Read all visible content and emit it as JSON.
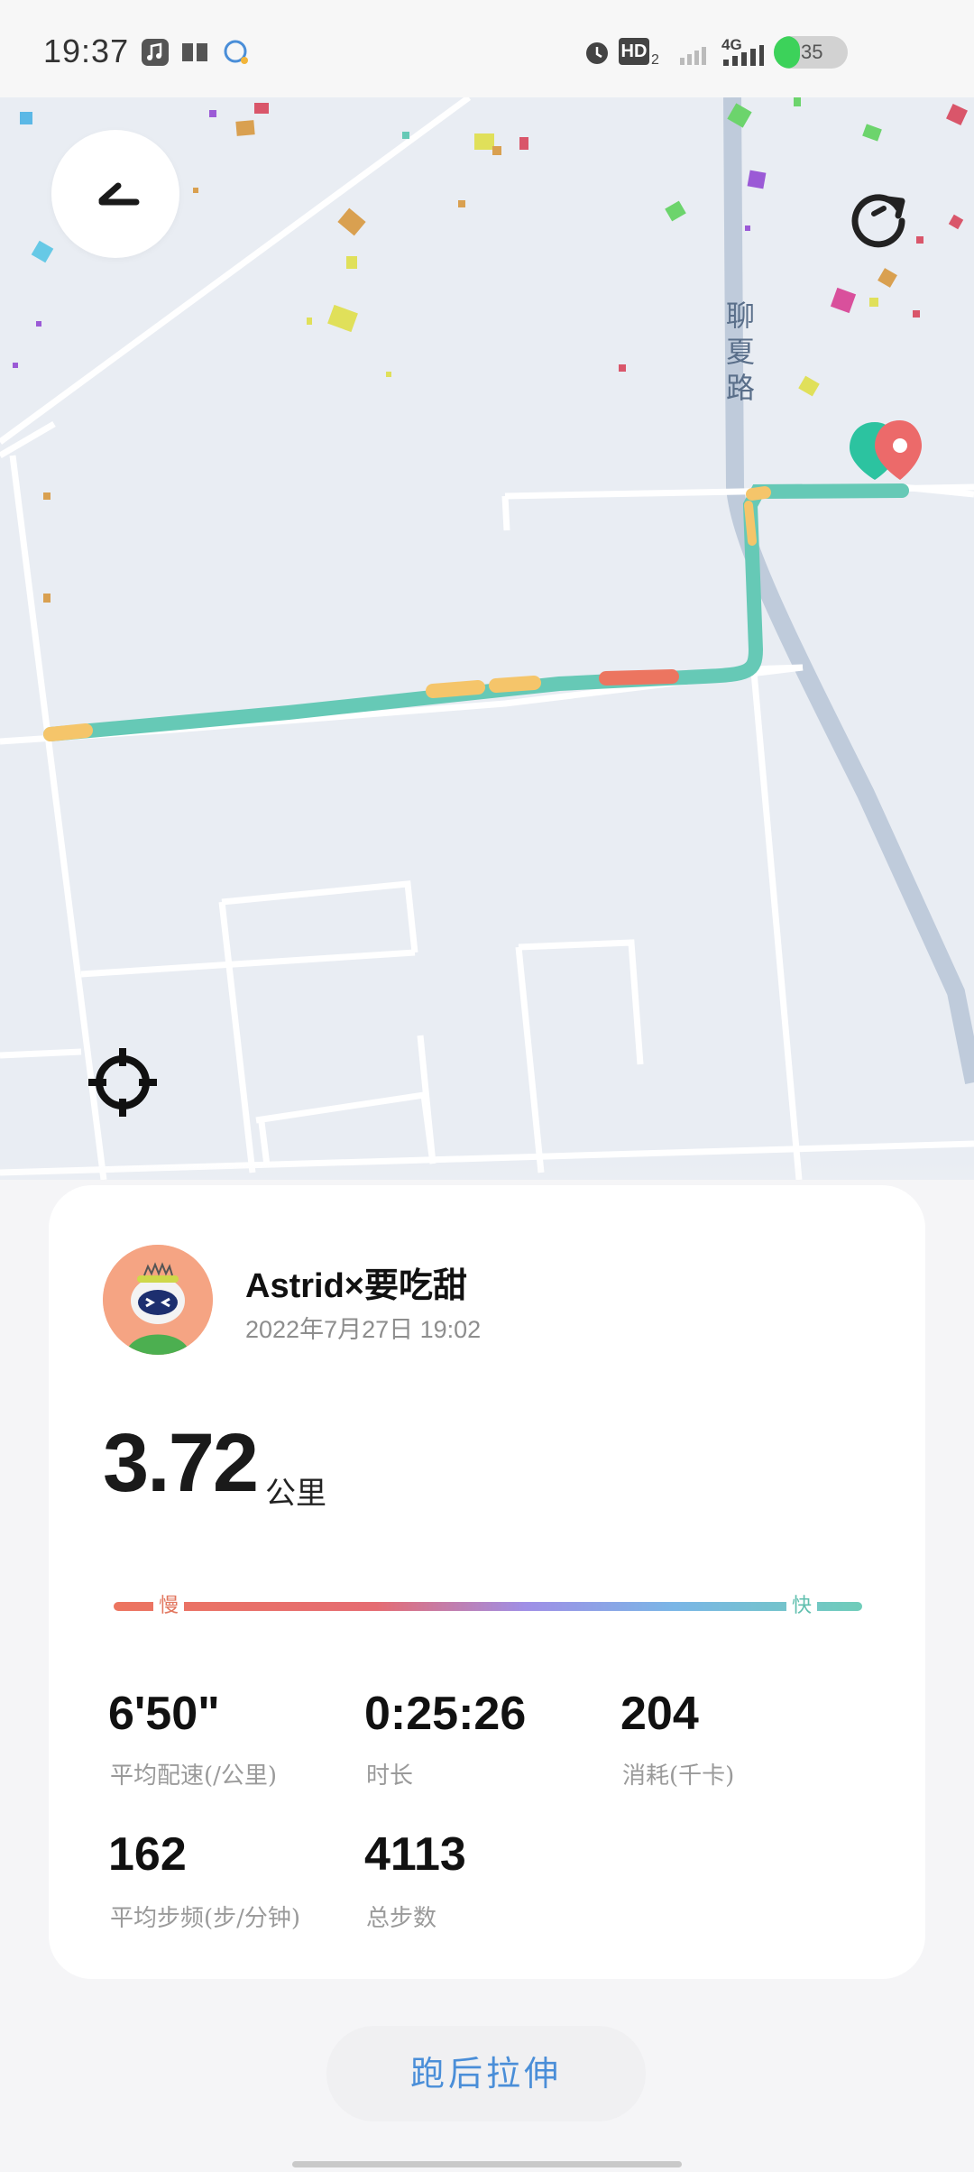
{
  "status_bar": {
    "time": "19:37",
    "battery": "35",
    "battery_level": 0.35,
    "signal_label": "4G",
    "hd_label": "HD",
    "icons": [
      "music-icon",
      "book-icon",
      "chat-icon",
      "alarm-icon",
      "hd-icon",
      "wifi-signal-icon",
      "cellular-signal-icon",
      "battery-icon"
    ]
  },
  "map": {
    "road_label": "聊夏路",
    "controls": [
      "back-icon",
      "replay-icon",
      "locate-icon",
      "start-end-pin-icon"
    ]
  },
  "run": {
    "user_name": "Astrid×要吃甜",
    "date": "2022年7月27日 19:02",
    "distance": "3.72",
    "distance_unit": "公里",
    "pace_slow_label": "慢",
    "pace_fast_label": "快",
    "stats": [
      {
        "value": "6'50\"",
        "label": "平均配速(/公里)"
      },
      {
        "value": "0:25:26",
        "label": "时长"
      },
      {
        "value": "204",
        "label": "消耗(千卡)"
      },
      {
        "value": "162",
        "label": "平均步频(步/分钟)"
      },
      {
        "value": "4113",
        "label": "总步数"
      }
    ]
  },
  "actions": {
    "stretch_label": "跑后拉伸"
  },
  "colors": {
    "route_fast": "#66c9b6",
    "route_mid": "#f5c56a",
    "route_slow": "#ec7560",
    "accent_blue": "#4a8ed8"
  }
}
